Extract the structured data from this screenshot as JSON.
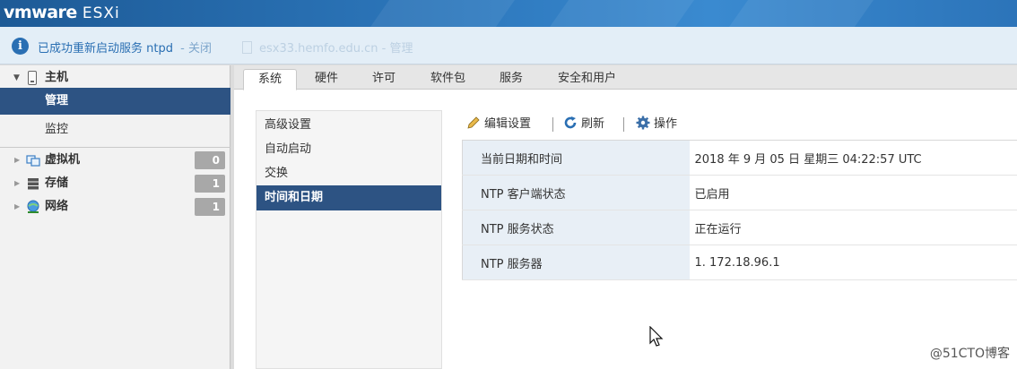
{
  "header": {
    "brand": "vmware",
    "product": "ESXi"
  },
  "notification": {
    "message": "已成功重新启动服务 ntpd",
    "close_label": "- 关闭",
    "faded_text": "esx33.hemfo.edu.cn - 管理"
  },
  "navigator": {
    "host_label": "主机",
    "manage_label": "管理",
    "monitor_label": "监控",
    "items": [
      {
        "label": "虚拟机",
        "count": "0",
        "icon": "vm-icon"
      },
      {
        "label": "存储",
        "count": "1",
        "icon": "storage-icon"
      },
      {
        "label": "网络",
        "count": "1",
        "icon": "network-icon"
      }
    ]
  },
  "tabs": [
    {
      "label": "系统",
      "active": true
    },
    {
      "label": "硬件"
    },
    {
      "label": "许可"
    },
    {
      "label": "软件包"
    },
    {
      "label": "服务"
    },
    {
      "label": "安全和用户"
    }
  ],
  "subnav": [
    {
      "label": "高级设置"
    },
    {
      "label": "自动启动"
    },
    {
      "label": "交换"
    },
    {
      "label": "时间和日期",
      "active": true
    }
  ],
  "toolbar": {
    "edit_label": "编辑设置",
    "refresh_label": "刷新",
    "actions_label": "操作"
  },
  "properties": [
    {
      "key": "当前日期和时间",
      "value": "2018 年 9 月 05 日 星期三 04:22:57 UTC"
    },
    {
      "key": "NTP 客户端状态",
      "value": "已启用"
    },
    {
      "key": "NTP 服务状态",
      "value": "正在运行"
    },
    {
      "key": "NTP 服务器",
      "value": "1. 172.18.96.1"
    }
  ],
  "watermark": "@51CTO博客",
  "colors": {
    "header": "#2d78bd",
    "selected": "#2d5383",
    "badge": "#a8a8a8",
    "info": "#2a6fb3"
  }
}
